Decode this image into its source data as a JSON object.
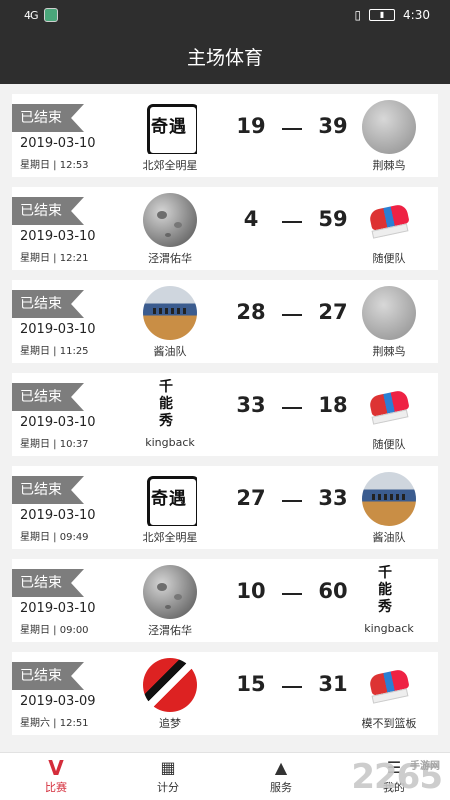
{
  "status_bar": {
    "network": "4G",
    "time": "4:30"
  },
  "header": {
    "title": "主场体育"
  },
  "matches": [
    {
      "status": "已结束",
      "date": "2019-03-10",
      "weekday_time": "星期日 | 12:53",
      "home": {
        "name": "北郊全明星",
        "logo": "calligraphy-logo"
      },
      "home_score": "19",
      "away_score": "39",
      "away": {
        "name": "荆棘鸟",
        "logo": "grey-disc-logo"
      }
    },
    {
      "status": "已结束",
      "date": "2019-03-10",
      "weekday_time": "星期日 | 12:21",
      "home": {
        "name": "泾渭佑华",
        "logo": "moon-logo"
      },
      "home_score": "4",
      "away_score": "59",
      "away": {
        "name": "随便队",
        "logo": "sneakers-logo"
      }
    },
    {
      "status": "已结束",
      "date": "2019-03-10",
      "weekday_time": "星期日 | 11:25",
      "home": {
        "name": "酱油队",
        "logo": "court-logo"
      },
      "home_score": "28",
      "away_score": "27",
      "away": {
        "name": "荆棘鸟",
        "logo": "grey-disc-logo"
      }
    },
    {
      "status": "已结束",
      "date": "2019-03-10",
      "weekday_time": "星期日 | 10:37",
      "home": {
        "name": "kingback",
        "logo": "kingback-logo"
      },
      "home_score": "33",
      "away_score": "18",
      "away": {
        "name": "随便队",
        "logo": "sneakers-logo"
      }
    },
    {
      "status": "已结束",
      "date": "2019-03-10",
      "weekday_time": "星期日 | 09:49",
      "home": {
        "name": "北郊全明星",
        "logo": "calligraphy-logo"
      },
      "home_score": "27",
      "away_score": "33",
      "away": {
        "name": "酱油队",
        "logo": "court-logo"
      }
    },
    {
      "status": "已结束",
      "date": "2019-03-10",
      "weekday_time": "星期日 | 09:00",
      "home": {
        "name": "泾渭佑华",
        "logo": "moon-logo"
      },
      "home_score": "10",
      "away_score": "60",
      "away": {
        "name": "kingback",
        "logo": "kingback-logo"
      }
    },
    {
      "status": "已结束",
      "date": "2019-03-09",
      "weekday_time": "星期六 | 12:51",
      "home": {
        "name": "追梦",
        "logo": "red-sneaker-logo"
      },
      "home_score": "15",
      "away_score": "31",
      "away": {
        "name": "模不到篮板",
        "logo": "sneakers-logo"
      }
    }
  ],
  "tabs": [
    {
      "label": "比赛",
      "icon": "v-logo-icon",
      "active": true
    },
    {
      "label": "计分",
      "icon": "scoreboard-icon",
      "active": false
    },
    {
      "label": "服务",
      "icon": "triangle-icon",
      "active": false
    },
    {
      "label": "我的",
      "icon": "person-icon",
      "active": false
    }
  ],
  "watermark": {
    "text": "2265",
    "sub": "手游网"
  }
}
